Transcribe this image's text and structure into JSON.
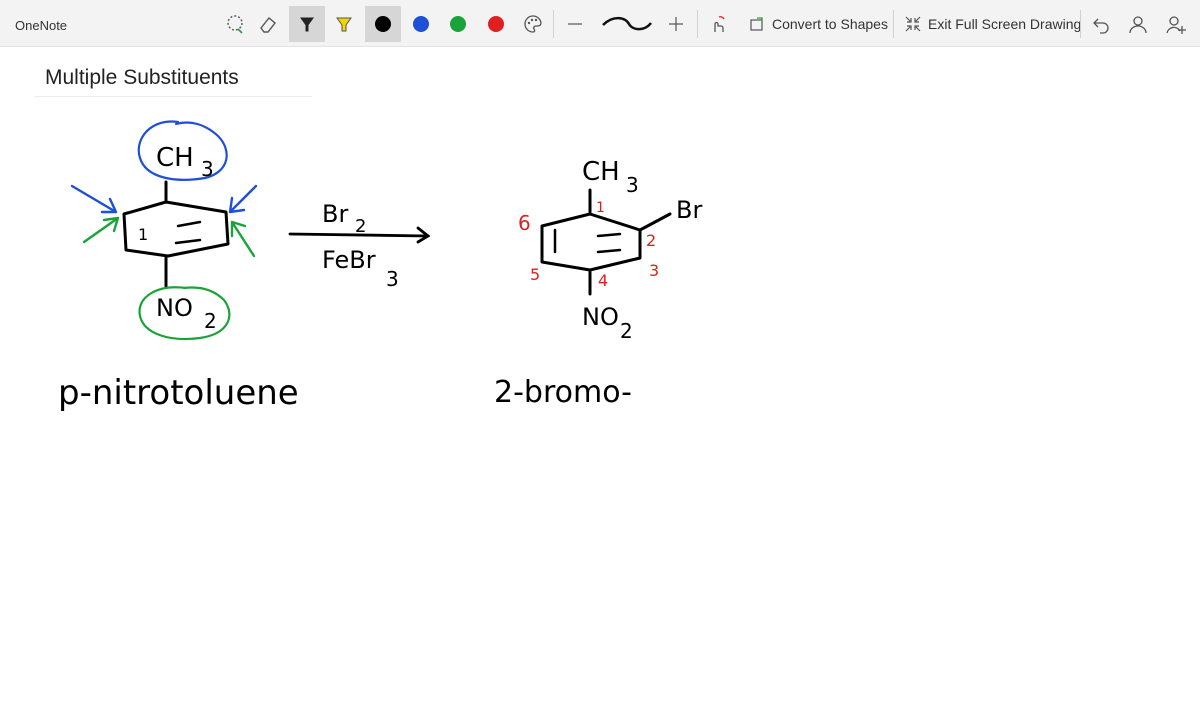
{
  "app": {
    "name": "OneNote"
  },
  "toolbar": {
    "convert_label": "Convert to Shapes",
    "exit_label": "Exit Full Screen Drawing",
    "colors": {
      "black": "#000000",
      "blue": "#1e4fd8",
      "green": "#1aa33a",
      "red": "#e02020",
      "highlighter": "#f2d400"
    }
  },
  "page": {
    "title": "Multiple Substituents"
  },
  "ink": {
    "left_molecule": {
      "top_group": "CH",
      "top_sub": "3",
      "bottom_group": "NO",
      "bottom_sub": "2",
      "ring_mark": "1",
      "name": "p-nitrotoluene"
    },
    "reagents": {
      "above": "Br",
      "above_sub": "2",
      "below": "FeBr",
      "below_sub": "3"
    },
    "right_molecule": {
      "top_group": "CH",
      "top_sub": "3",
      "side_group": "Br",
      "bottom_group": "NO",
      "bottom_sub": "2",
      "ring_mark": "1",
      "numbers": [
        "1",
        "2",
        "3",
        "4",
        "5",
        "6"
      ],
      "name_partial": "2-bromo-"
    }
  }
}
